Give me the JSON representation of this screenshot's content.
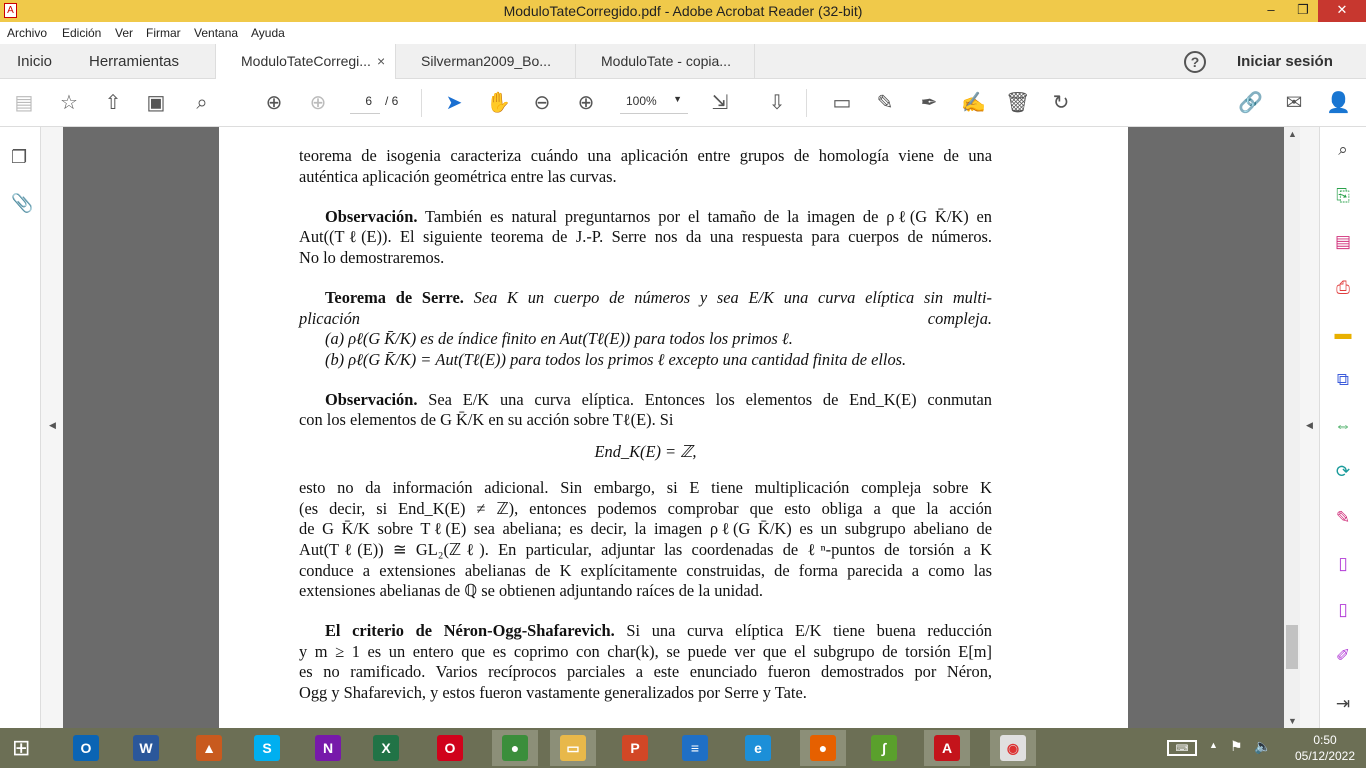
{
  "window": {
    "title": "ModuloTateCorregido.pdf - Adobe Acrobat Reader (32-bit)"
  },
  "menu": [
    "Archivo",
    "Edición",
    "Ver",
    "Firmar",
    "Ventana",
    "Ayuda"
  ],
  "tabs": {
    "home": "Inicio",
    "tools": "Herramientas",
    "docs": [
      "ModuloTateCorregi...",
      "Silverman2009_Bo...",
      "ModuloTate - copia..."
    ],
    "help": "?",
    "signin": "Iniciar sesión"
  },
  "toolbar": {
    "page_current": "6",
    "page_total": "/ 6",
    "zoom": "100%"
  },
  "document": {
    "paragraphs": [
      {
        "lines": [
          "teorema de isogenia caracteriza cuándo una aplicación entre grupos de homología viene de una",
          "auténtica aplicación geométrica entre las curvas."
        ]
      },
      {
        "lead": "Observación.",
        "lines": [
          " También es natural preguntarnos por el tamaño de la imagen de ρℓ(G K̄/K) en",
          "Aut((Tℓ(E)). El siguiente teorema de J.-P. Serre nos da una respuesta para cuerpos de números.",
          "No lo demostraremos."
        ]
      },
      {
        "lead": "Teorema de Serre.",
        "italic": true,
        "lines": [
          " Sea K un cuerpo de números y sea E/K una curva elíptica sin multi-",
          "plicación compleja.",
          "(a) ρℓ(G K̄/K) es de índice finito en Aut(Tℓ(E)) para todos los primos ℓ.",
          "(b) ρℓ(G K̄/K) = Aut(Tℓ(E)) para todos los primos ℓ excepto una cantidad finita de ellos."
        ]
      },
      {
        "lead": "Observación.",
        "lines": [
          " Sea E/K una curva elíptica. Entonces los elementos de End_K(E) conmutan",
          "con los elementos de G K̄/K en su acción sobre Tℓ(E). Si"
        ]
      },
      {
        "center": true,
        "lines": [
          "End_K(E) = ℤ,"
        ]
      },
      {
        "lines": [
          "esto no da información adicional. Sin embargo, si E tiene multiplicación compleja sobre K",
          "(es decir, si End_K(E) ≠ ℤ), entonces podemos comprobar que esto obliga a que la acción",
          "de G K̄/K sobre Tℓ(E) sea abeliana; es decir, la imagen ρℓ(G K̄/K) es un subgrupo abeliano de",
          "Aut(Tℓ(E)) ≅ GL₂(ℤℓ). En particular, adjuntar las coordenadas de ℓⁿ-puntos de torsión a K",
          "conduce a extensiones abelianas de K explícitamente construidas, de forma parecida a como las",
          "extensiones abelianas de ℚ se obtienen adjuntando raíces de la unidad."
        ]
      },
      {
        "lead": "El criterio de Néron-Ogg-Shafarevich.",
        "lines": [
          " Si una curva elíptica E/K tiene buena reducción",
          "y m ≥ 1 es un entero que es coprimo con char(k), se puede ver que el subgrupo de torsión E[m]",
          "es no ramificado. Varios recíprocos parciales a este enunciado fueron demostrados por Néron,",
          "Ogg y Shafarevich, y estos fueron vastamente generalizados por Serre y Tate."
        ]
      }
    ]
  },
  "taskbar": {
    "apps": [
      {
        "name": "outlook",
        "label": "O",
        "color": "#0a64b4"
      },
      {
        "name": "word",
        "label": "W",
        "color": "#2b579a"
      },
      {
        "name": "matlab",
        "label": "▲",
        "color": "#c85a1e"
      },
      {
        "name": "skype",
        "label": "S",
        "color": "#00aff0"
      },
      {
        "name": "onenote",
        "label": "N",
        "color": "#7719aa"
      },
      {
        "name": "excel",
        "label": "X",
        "color": "#217346"
      },
      {
        "name": "opera",
        "label": "O",
        "color": "#d0021b"
      },
      {
        "name": "chrome",
        "label": "●",
        "color": "#3b8e3b"
      },
      {
        "name": "file-explorer",
        "label": "▭",
        "color": "#e8b84a"
      },
      {
        "name": "powerpoint",
        "label": "P",
        "color": "#d24726"
      },
      {
        "name": "scanner",
        "label": "≡",
        "color": "#1f6fc5"
      },
      {
        "name": "edge",
        "label": "e",
        "color": "#1c8fd8"
      },
      {
        "name": "firefox",
        "label": "●",
        "color": "#e66000"
      },
      {
        "name": "geogebra-app",
        "label": "∫",
        "color": "#5aa02c"
      },
      {
        "name": "acrobat",
        "label": "A",
        "color": "#c4141b"
      },
      {
        "name": "recorder",
        "label": "◉",
        "color": "#e0e0e0"
      }
    ],
    "time": "0:50",
    "date": "05/12/2022"
  }
}
